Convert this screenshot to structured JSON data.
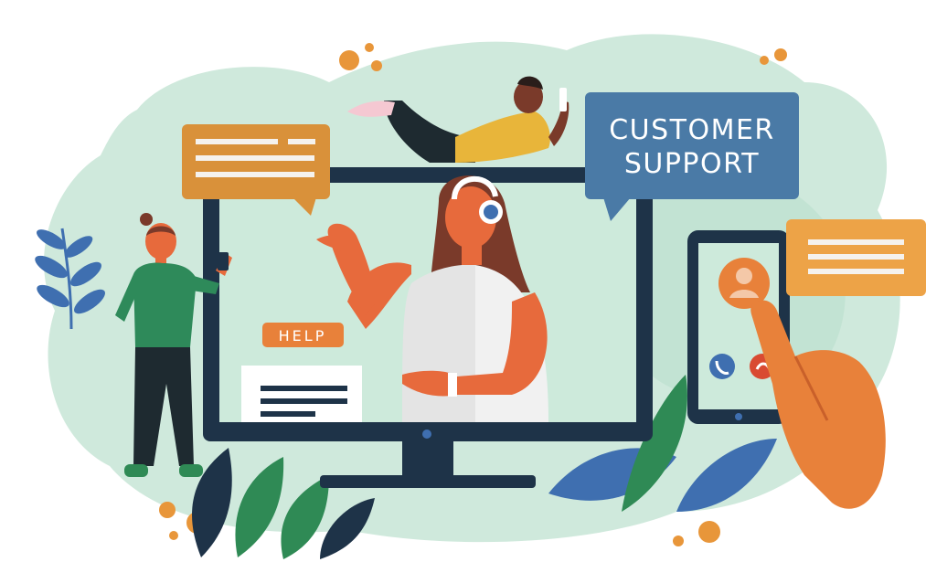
{
  "illustration": {
    "banner_line1": "CUSTOMER",
    "banner_line2": "SUPPORT",
    "help_label": "HELP"
  },
  "colors": {
    "blob": "#cfe9dc",
    "blob_dark": "#9fd2bd",
    "navy": "#1e3348",
    "screen": "#cdeadb",
    "orange": "#e8813a",
    "amber": "#d9913a",
    "blue_banner": "#4a7aa6",
    "skin": "#e76a3c",
    "hair": "#7a3a2a",
    "green_shirt": "#2e8a5a",
    "leaf_blue": "#3f6fb0",
    "leaf_green": "#2f8a55"
  },
  "icons": [
    "headset-icon",
    "user-avatar-icon",
    "phone-accept-icon",
    "phone-decline-icon",
    "tablet-icon",
    "smartphone-icon",
    "monitor-icon"
  ]
}
